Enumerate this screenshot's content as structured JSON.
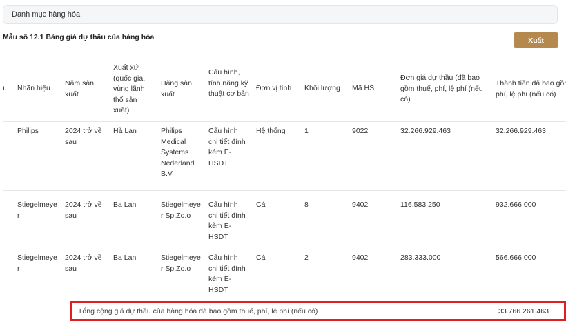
{
  "tab": {
    "label": "Danh mục hàng hóa"
  },
  "title": "Mẫu số 12.1 Bảng giá dự thầu của hàng hóa",
  "export_label": "Xuất Excel",
  "headers": {
    "stub": "ı",
    "brand": "Nhãn hiệu",
    "year": "Năm sản xuất",
    "origin": "Xuất xứ (quốc gia, vùng lãnh thổ sản xuất)",
    "maker": "Hãng sản xuất",
    "config": "Cấu hình, tính năng kỹ thuật cơ bản",
    "unit": "Đơn vị tính",
    "qty": "Khối lượng",
    "hs": "Mã HS",
    "price": "Đơn giá dự thầu (đã bao gồm thuế, phí, lệ phí (nếu có)",
    "total": "Thành tiền đã bao gồm thuế, phí, lệ phí (nếu có)"
  },
  "rows": [
    {
      "brand": "Philips",
      "year": "2024 trở về sau",
      "origin": "Hà Lan",
      "maker": "Philips Medical Systems Nederland B.V",
      "config": "Cấu hình chi tiết đính kèm E-HSDT",
      "unit": "Hệ thống",
      "qty": "1",
      "hs": "9022",
      "price": "32.266.929.463",
      "total": "32.266.929.463"
    },
    {
      "brand": "Stiegelmeyer",
      "year": "2024 trở về sau",
      "origin": "Ba Lan",
      "maker": "Stiegelmeyer Sp.Zo.o",
      "config": "Cấu hình chi tiết đính kèm E-HSDT",
      "unit": "Cái",
      "qty": "8",
      "hs": "9402",
      "price": "116.583.250",
      "total": "932.666.000"
    },
    {
      "brand": "Stiegelmeyer",
      "year": "2024 trở về sau",
      "origin": "Ba Lan",
      "maker": "Stiegelmeyer Sp.Zo.o",
      "config": "Cấu hình chi tiết đính kèm E-HSDT",
      "unit": "Cái",
      "qty": "2",
      "hs": "9402",
      "price": "283.333.000",
      "total": "566.666.000"
    }
  ],
  "footer": {
    "label": "Tổng cộng giá dự thầu của hàng hóa đã bao gồm thuế, phí, lệ phí (nếu có)",
    "value": "33.766.261.463"
  },
  "colors": {
    "export_button": "#b5894d",
    "highlight_border": "#e02020"
  }
}
